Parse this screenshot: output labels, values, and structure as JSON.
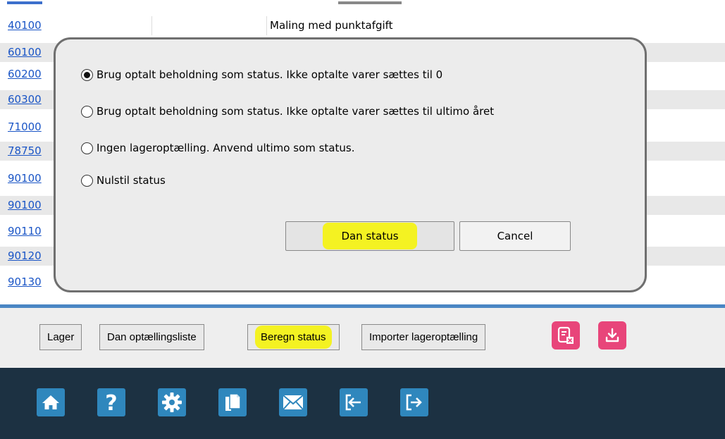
{
  "table": {
    "rows": [
      {
        "code": "40100",
        "description": "Maling med punktafgift"
      },
      {
        "code": "60100",
        "description": ""
      },
      {
        "code": "60200",
        "description": ""
      },
      {
        "code": "60300",
        "description": ""
      },
      {
        "code": "71000",
        "description": ""
      },
      {
        "code": "78750",
        "description": ""
      },
      {
        "code": "90100",
        "description": ""
      },
      {
        "code": "90100",
        "description": ""
      },
      {
        "code": "90110",
        "description": ""
      },
      {
        "code": "90120",
        "description": ""
      },
      {
        "code": "90130",
        "description": ""
      }
    ]
  },
  "dialog": {
    "options": [
      {
        "label": "Brug optalt beholdning som status. Ikke optalte varer sættes til 0",
        "selected": true
      },
      {
        "label": "Brug optalt beholdning som status. Ikke optalte varer sættes til ultimo året",
        "selected": false
      },
      {
        "label": "Ingen lageroptælling. Anvend ultimo som status.",
        "selected": false
      },
      {
        "label": "Nulstil status",
        "selected": false
      }
    ],
    "confirm_label": "Dan status",
    "cancel_label": "Cancel"
  },
  "toolbar": {
    "lager": "Lager",
    "dan_list": "Dan optællingsliste",
    "beregn": "Beregn status",
    "importer": "Importer lageroptælling",
    "icons": [
      "report-clear-icon",
      "download-icon"
    ]
  },
  "footer": {
    "icons": [
      "home-icon",
      "help-icon",
      "settings-icon",
      "copy-icon",
      "mail-icon",
      "login-icon",
      "logout-icon"
    ]
  },
  "colors": {
    "link": "#1a55c6",
    "highlight": "#f4f222",
    "accent_pink": "#e8457a",
    "footer_bg": "#1c3142",
    "footer_icon": "#2f87bd",
    "divider_blue": "#4a86c4"
  }
}
